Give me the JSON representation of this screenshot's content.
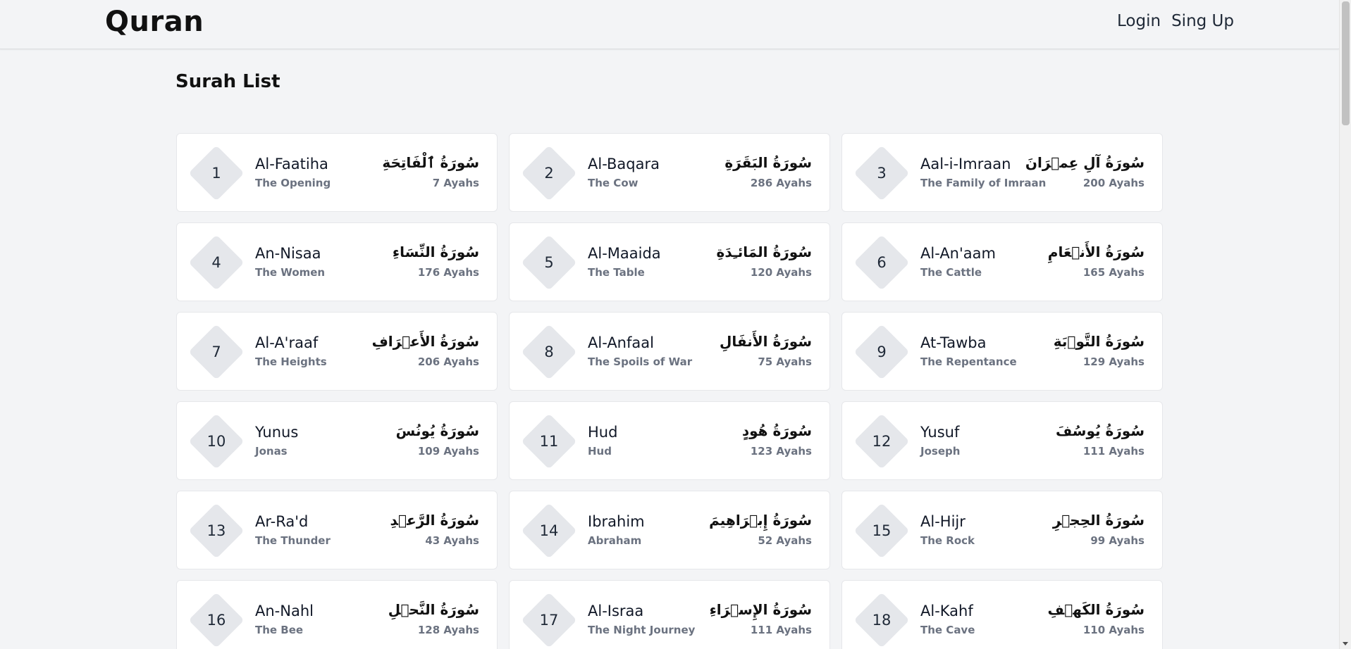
{
  "navbar": {
    "brand": "Quran",
    "links": [
      "Login",
      "Sing Up"
    ]
  },
  "page_title": "Surah List",
  "surahs": [
    {
      "number": "1",
      "name": "Al-Faatiha",
      "meaning": "The Opening",
      "arabic": "سُورَةُ ٱلْفَاتِحَةِ",
      "ayahs": "7 Ayahs"
    },
    {
      "number": "2",
      "name": "Al-Baqara",
      "meaning": "The Cow",
      "arabic": "سُورَةُ البَقَرَةِ",
      "ayahs": "286 Ayahs"
    },
    {
      "number": "3",
      "name": "Aal-i-Imraan",
      "meaning": "The Family of Imraan",
      "arabic": "سُورَةُ آلِ عِمۡرَانَ",
      "ayahs": "200 Ayahs"
    },
    {
      "number": "4",
      "name": "An-Nisaa",
      "meaning": "The Women",
      "arabic": "سُورَةُ النِّسَاءِ",
      "ayahs": "176 Ayahs"
    },
    {
      "number": "5",
      "name": "Al-Maaida",
      "meaning": "The Table",
      "arabic": "سُورَةُ المَائـِدَةِ",
      "ayahs": "120 Ayahs"
    },
    {
      "number": "6",
      "name": "Al-An'aam",
      "meaning": "The Cattle",
      "arabic": "سُورَةُ الأَنۡعَامِ",
      "ayahs": "165 Ayahs"
    },
    {
      "number": "7",
      "name": "Al-A'raaf",
      "meaning": "The Heights",
      "arabic": "سُورَةُ الأَعۡرَافِ",
      "ayahs": "206 Ayahs"
    },
    {
      "number": "8",
      "name": "Al-Anfaal",
      "meaning": "The Spoils of War",
      "arabic": "سُورَةُ الأَنفَالِ",
      "ayahs": "75 Ayahs"
    },
    {
      "number": "9",
      "name": "At-Tawba",
      "meaning": "The Repentance",
      "arabic": "سُورَةُ التَّوۡبَةِ",
      "ayahs": "129 Ayahs"
    },
    {
      "number": "10",
      "name": "Yunus",
      "meaning": "Jonas",
      "arabic": "سُورَةُ يُونُسَ",
      "ayahs": "109 Ayahs"
    },
    {
      "number": "11",
      "name": "Hud",
      "meaning": "Hud",
      "arabic": "سُورَةُ هُودٍ",
      "ayahs": "123 Ayahs"
    },
    {
      "number": "12",
      "name": "Yusuf",
      "meaning": "Joseph",
      "arabic": "سُورَةُ يُوسُفَ",
      "ayahs": "111 Ayahs"
    },
    {
      "number": "13",
      "name": "Ar-Ra'd",
      "meaning": "The Thunder",
      "arabic": "سُورَةُ الرَّعۡدِ",
      "ayahs": "43 Ayahs"
    },
    {
      "number": "14",
      "name": "Ibrahim",
      "meaning": "Abraham",
      "arabic": "سُورَةُ إِبۡرَاهِيمَ",
      "ayahs": "52 Ayahs"
    },
    {
      "number": "15",
      "name": "Al-Hijr",
      "meaning": "The Rock",
      "arabic": "سُورَةُ الحِجۡرِ",
      "ayahs": "99 Ayahs"
    },
    {
      "number": "16",
      "name": "An-Nahl",
      "meaning": "The Bee",
      "arabic": "سُورَةُ النَّحۡلِ",
      "ayahs": "128 Ayahs"
    },
    {
      "number": "17",
      "name": "Al-Israa",
      "meaning": "The Night Journey",
      "arabic": "سُورَةُ الإِسۡرَاءِ",
      "ayahs": "111 Ayahs"
    },
    {
      "number": "18",
      "name": "Al-Kahf",
      "meaning": "The Cave",
      "arabic": "سُورَةُ الكَهۡفِ",
      "ayahs": "110 Ayahs"
    }
  ]
}
